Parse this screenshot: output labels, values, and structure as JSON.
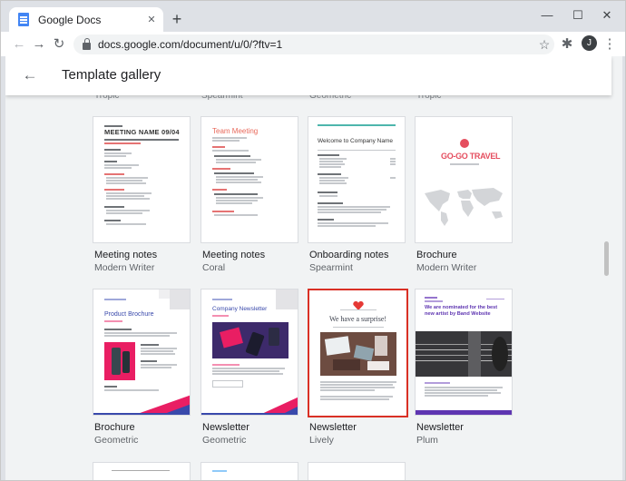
{
  "browser": {
    "tab_title": "Google Docs",
    "tab_close": "✕",
    "new_tab": "+",
    "url": "docs.google.com/document/u/0/?ftv=1",
    "profile_initial": "J",
    "window_controls": {
      "minimize": "—",
      "maximize": "☐",
      "close": "✕"
    },
    "nav": {
      "back": "←",
      "forward": "→",
      "reload": "↻"
    },
    "icons": {
      "star": "☆",
      "extensions": "✱",
      "menu": "⋮"
    }
  },
  "gallery": {
    "title": "Template gallery",
    "back_arrow": "←",
    "peek_labels": [
      "Tropic",
      "Spearmint",
      "Geometric",
      "Tropic"
    ],
    "rows": [
      [
        {
          "name": "Meeting notes",
          "style": "Modern Writer",
          "thumb_title": "MEETING NAME 09/04"
        },
        {
          "name": "Meeting notes",
          "style": "Coral",
          "thumb_title": "Team Meeting"
        },
        {
          "name": "Onboarding notes",
          "style": "Spearmint",
          "thumb_title": "Welcome to Company Name"
        },
        {
          "name": "Brochure",
          "style": "Modern Writer",
          "thumb_title": "GO-GO TRAVEL"
        }
      ],
      [
        {
          "name": "Brochure",
          "style": "Geometric",
          "thumb_title": "Product Brochure"
        },
        {
          "name": "Newsletter",
          "style": "Geometric",
          "thumb_title": "Company Newsletter"
        },
        {
          "name": "Newsletter",
          "style": "Lively",
          "thumb_title": "We have a surprise!"
        },
        {
          "name": "Newsletter",
          "style": "Plum",
          "thumb_title": "We are nominated for the best new artist by Band Website"
        }
      ]
    ]
  }
}
